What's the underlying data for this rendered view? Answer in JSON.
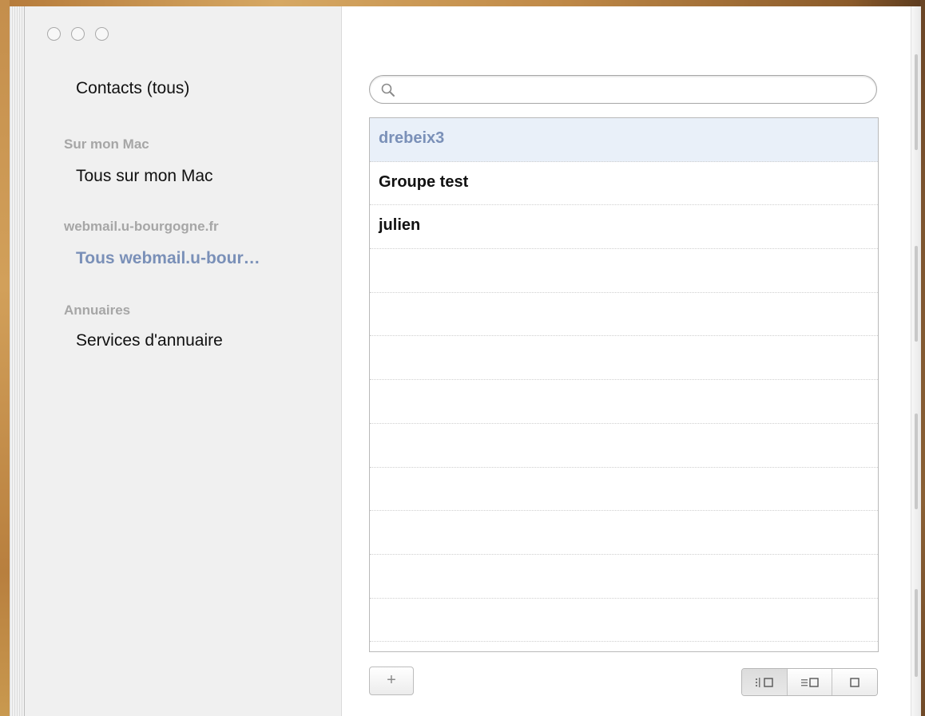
{
  "sidebar": {
    "all_contacts": "Contacts (tous)",
    "sections": [
      {
        "header": "Sur mon Mac",
        "items": [
          {
            "label": "Tous sur mon Mac",
            "selected": false
          }
        ]
      },
      {
        "header": "webmail.u-bourgogne.fr",
        "items": [
          {
            "label": "Tous webmail.u-bour…",
            "selected": true
          }
        ]
      },
      {
        "header": "Annuaires",
        "items": [
          {
            "label": "Services d'annuaire",
            "selected": false
          }
        ]
      }
    ]
  },
  "search": {
    "value": "",
    "placeholder": ""
  },
  "groups": [
    {
      "name": "drebeix3",
      "selected": true
    },
    {
      "name": "Groupe test",
      "selected": false
    },
    {
      "name": "julien",
      "selected": false
    }
  ],
  "toolbar": {
    "add_label": "+",
    "view_modes": [
      {
        "icon": "groups-and-card-view-icon",
        "active": true
      },
      {
        "icon": "list-and-card-view-icon",
        "active": false
      },
      {
        "icon": "card-only-view-icon",
        "active": false
      }
    ]
  },
  "colors": {
    "accent": "#7a90b8",
    "selection_bg": "#e9f0f9",
    "sidebar_bg": "#f0f0f0",
    "section_header": "#a6a6a6"
  }
}
